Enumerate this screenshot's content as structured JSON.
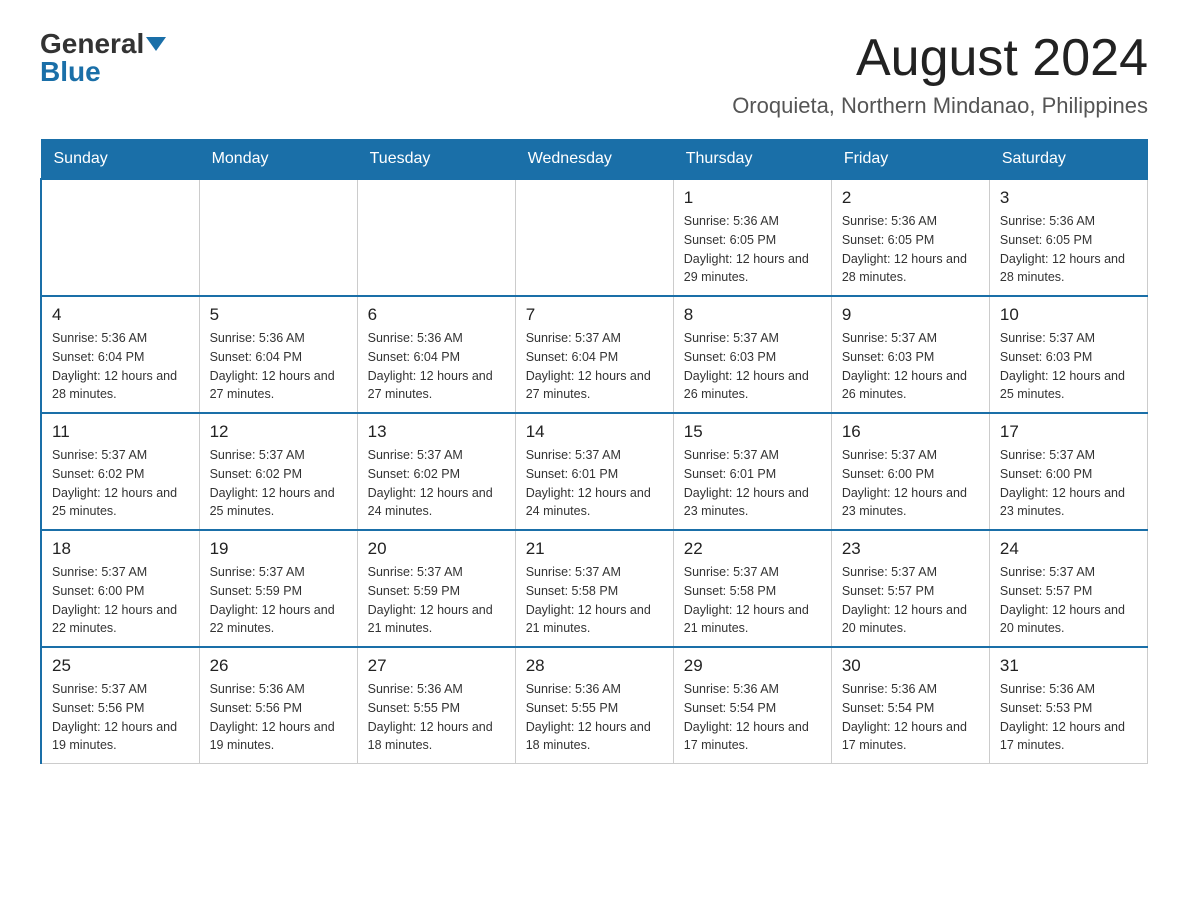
{
  "logo": {
    "general": "General",
    "blue": "Blue"
  },
  "title": {
    "month": "August 2024",
    "location": "Oroquieta, Northern Mindanao, Philippines"
  },
  "weekdays": [
    "Sunday",
    "Monday",
    "Tuesday",
    "Wednesday",
    "Thursday",
    "Friday",
    "Saturday"
  ],
  "weeks": [
    [
      {
        "day": "",
        "info": ""
      },
      {
        "day": "",
        "info": ""
      },
      {
        "day": "",
        "info": ""
      },
      {
        "day": "",
        "info": ""
      },
      {
        "day": "1",
        "info": "Sunrise: 5:36 AM\nSunset: 6:05 PM\nDaylight: 12 hours and 29 minutes."
      },
      {
        "day": "2",
        "info": "Sunrise: 5:36 AM\nSunset: 6:05 PM\nDaylight: 12 hours and 28 minutes."
      },
      {
        "day": "3",
        "info": "Sunrise: 5:36 AM\nSunset: 6:05 PM\nDaylight: 12 hours and 28 minutes."
      }
    ],
    [
      {
        "day": "4",
        "info": "Sunrise: 5:36 AM\nSunset: 6:04 PM\nDaylight: 12 hours and 28 minutes."
      },
      {
        "day": "5",
        "info": "Sunrise: 5:36 AM\nSunset: 6:04 PM\nDaylight: 12 hours and 27 minutes."
      },
      {
        "day": "6",
        "info": "Sunrise: 5:36 AM\nSunset: 6:04 PM\nDaylight: 12 hours and 27 minutes."
      },
      {
        "day": "7",
        "info": "Sunrise: 5:37 AM\nSunset: 6:04 PM\nDaylight: 12 hours and 27 minutes."
      },
      {
        "day": "8",
        "info": "Sunrise: 5:37 AM\nSunset: 6:03 PM\nDaylight: 12 hours and 26 minutes."
      },
      {
        "day": "9",
        "info": "Sunrise: 5:37 AM\nSunset: 6:03 PM\nDaylight: 12 hours and 26 minutes."
      },
      {
        "day": "10",
        "info": "Sunrise: 5:37 AM\nSunset: 6:03 PM\nDaylight: 12 hours and 25 minutes."
      }
    ],
    [
      {
        "day": "11",
        "info": "Sunrise: 5:37 AM\nSunset: 6:02 PM\nDaylight: 12 hours and 25 minutes."
      },
      {
        "day": "12",
        "info": "Sunrise: 5:37 AM\nSunset: 6:02 PM\nDaylight: 12 hours and 25 minutes."
      },
      {
        "day": "13",
        "info": "Sunrise: 5:37 AM\nSunset: 6:02 PM\nDaylight: 12 hours and 24 minutes."
      },
      {
        "day": "14",
        "info": "Sunrise: 5:37 AM\nSunset: 6:01 PM\nDaylight: 12 hours and 24 minutes."
      },
      {
        "day": "15",
        "info": "Sunrise: 5:37 AM\nSunset: 6:01 PM\nDaylight: 12 hours and 23 minutes."
      },
      {
        "day": "16",
        "info": "Sunrise: 5:37 AM\nSunset: 6:00 PM\nDaylight: 12 hours and 23 minutes."
      },
      {
        "day": "17",
        "info": "Sunrise: 5:37 AM\nSunset: 6:00 PM\nDaylight: 12 hours and 23 minutes."
      }
    ],
    [
      {
        "day": "18",
        "info": "Sunrise: 5:37 AM\nSunset: 6:00 PM\nDaylight: 12 hours and 22 minutes."
      },
      {
        "day": "19",
        "info": "Sunrise: 5:37 AM\nSunset: 5:59 PM\nDaylight: 12 hours and 22 minutes."
      },
      {
        "day": "20",
        "info": "Sunrise: 5:37 AM\nSunset: 5:59 PM\nDaylight: 12 hours and 21 minutes."
      },
      {
        "day": "21",
        "info": "Sunrise: 5:37 AM\nSunset: 5:58 PM\nDaylight: 12 hours and 21 minutes."
      },
      {
        "day": "22",
        "info": "Sunrise: 5:37 AM\nSunset: 5:58 PM\nDaylight: 12 hours and 21 minutes."
      },
      {
        "day": "23",
        "info": "Sunrise: 5:37 AM\nSunset: 5:57 PM\nDaylight: 12 hours and 20 minutes."
      },
      {
        "day": "24",
        "info": "Sunrise: 5:37 AM\nSunset: 5:57 PM\nDaylight: 12 hours and 20 minutes."
      }
    ],
    [
      {
        "day": "25",
        "info": "Sunrise: 5:37 AM\nSunset: 5:56 PM\nDaylight: 12 hours and 19 minutes."
      },
      {
        "day": "26",
        "info": "Sunrise: 5:36 AM\nSunset: 5:56 PM\nDaylight: 12 hours and 19 minutes."
      },
      {
        "day": "27",
        "info": "Sunrise: 5:36 AM\nSunset: 5:55 PM\nDaylight: 12 hours and 18 minutes."
      },
      {
        "day": "28",
        "info": "Sunrise: 5:36 AM\nSunset: 5:55 PM\nDaylight: 12 hours and 18 minutes."
      },
      {
        "day": "29",
        "info": "Sunrise: 5:36 AM\nSunset: 5:54 PM\nDaylight: 12 hours and 17 minutes."
      },
      {
        "day": "30",
        "info": "Sunrise: 5:36 AM\nSunset: 5:54 PM\nDaylight: 12 hours and 17 minutes."
      },
      {
        "day": "31",
        "info": "Sunrise: 5:36 AM\nSunset: 5:53 PM\nDaylight: 12 hours and 17 minutes."
      }
    ]
  ]
}
